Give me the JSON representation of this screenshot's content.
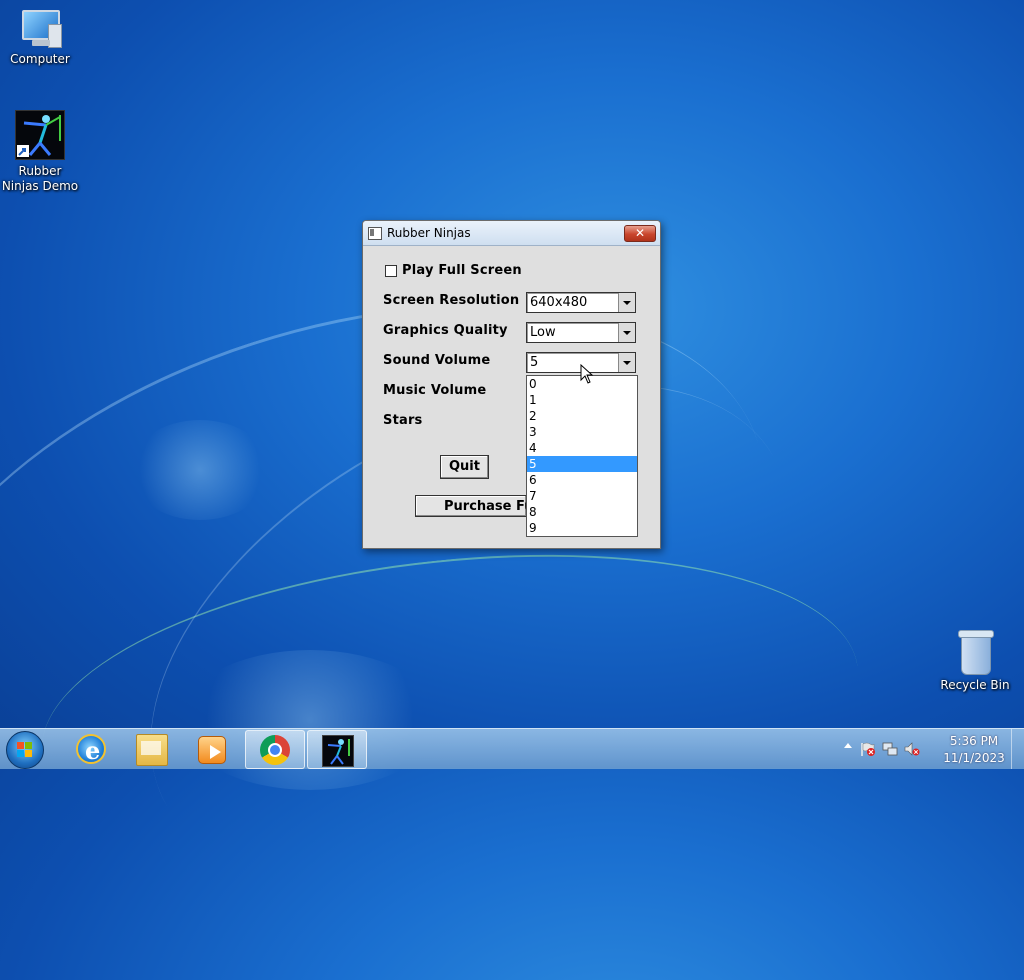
{
  "desktop": {
    "icons": [
      {
        "label": "Computer",
        "icon": "computer-icon"
      },
      {
        "label": "Rubber Ninjas Demo",
        "icon": "rubber-ninjas-icon"
      },
      {
        "label": "Recycle Bin",
        "icon": "recycle-bin-icon"
      }
    ]
  },
  "dialog": {
    "title": "Rubber Ninjas",
    "close_label": "✕",
    "full_screen": {
      "label": "Play Full Screen",
      "checked": false
    },
    "fields": [
      {
        "label": "Screen Resolution",
        "value": "640x480"
      },
      {
        "label": "Graphics Quality",
        "value": "Low"
      },
      {
        "label": "Sound Volume",
        "value": "5"
      },
      {
        "label": "Music Volume",
        "value": ""
      },
      {
        "label": "Stars",
        "value": ""
      }
    ],
    "quit_label": "Quit",
    "purchase_label": "Purchase Fu",
    "dropdown": {
      "options": [
        "0",
        "1",
        "2",
        "3",
        "4",
        "5",
        "6",
        "7",
        "8",
        "9"
      ],
      "selected": "5"
    }
  },
  "taskbar": {
    "items": [
      {
        "icon": "start-button-icon"
      },
      {
        "icon": "internet-explorer-icon"
      },
      {
        "icon": "file-explorer-icon"
      },
      {
        "icon": "media-player-icon"
      },
      {
        "icon": "chrome-icon"
      },
      {
        "icon": "rubber-ninjas-icon"
      }
    ],
    "clock": {
      "time": "5:36 PM",
      "date": "11/1/2023"
    }
  },
  "colors": {
    "selection": "#3399ff",
    "close": "#c9452c",
    "desktop": "#1a6fd0"
  }
}
